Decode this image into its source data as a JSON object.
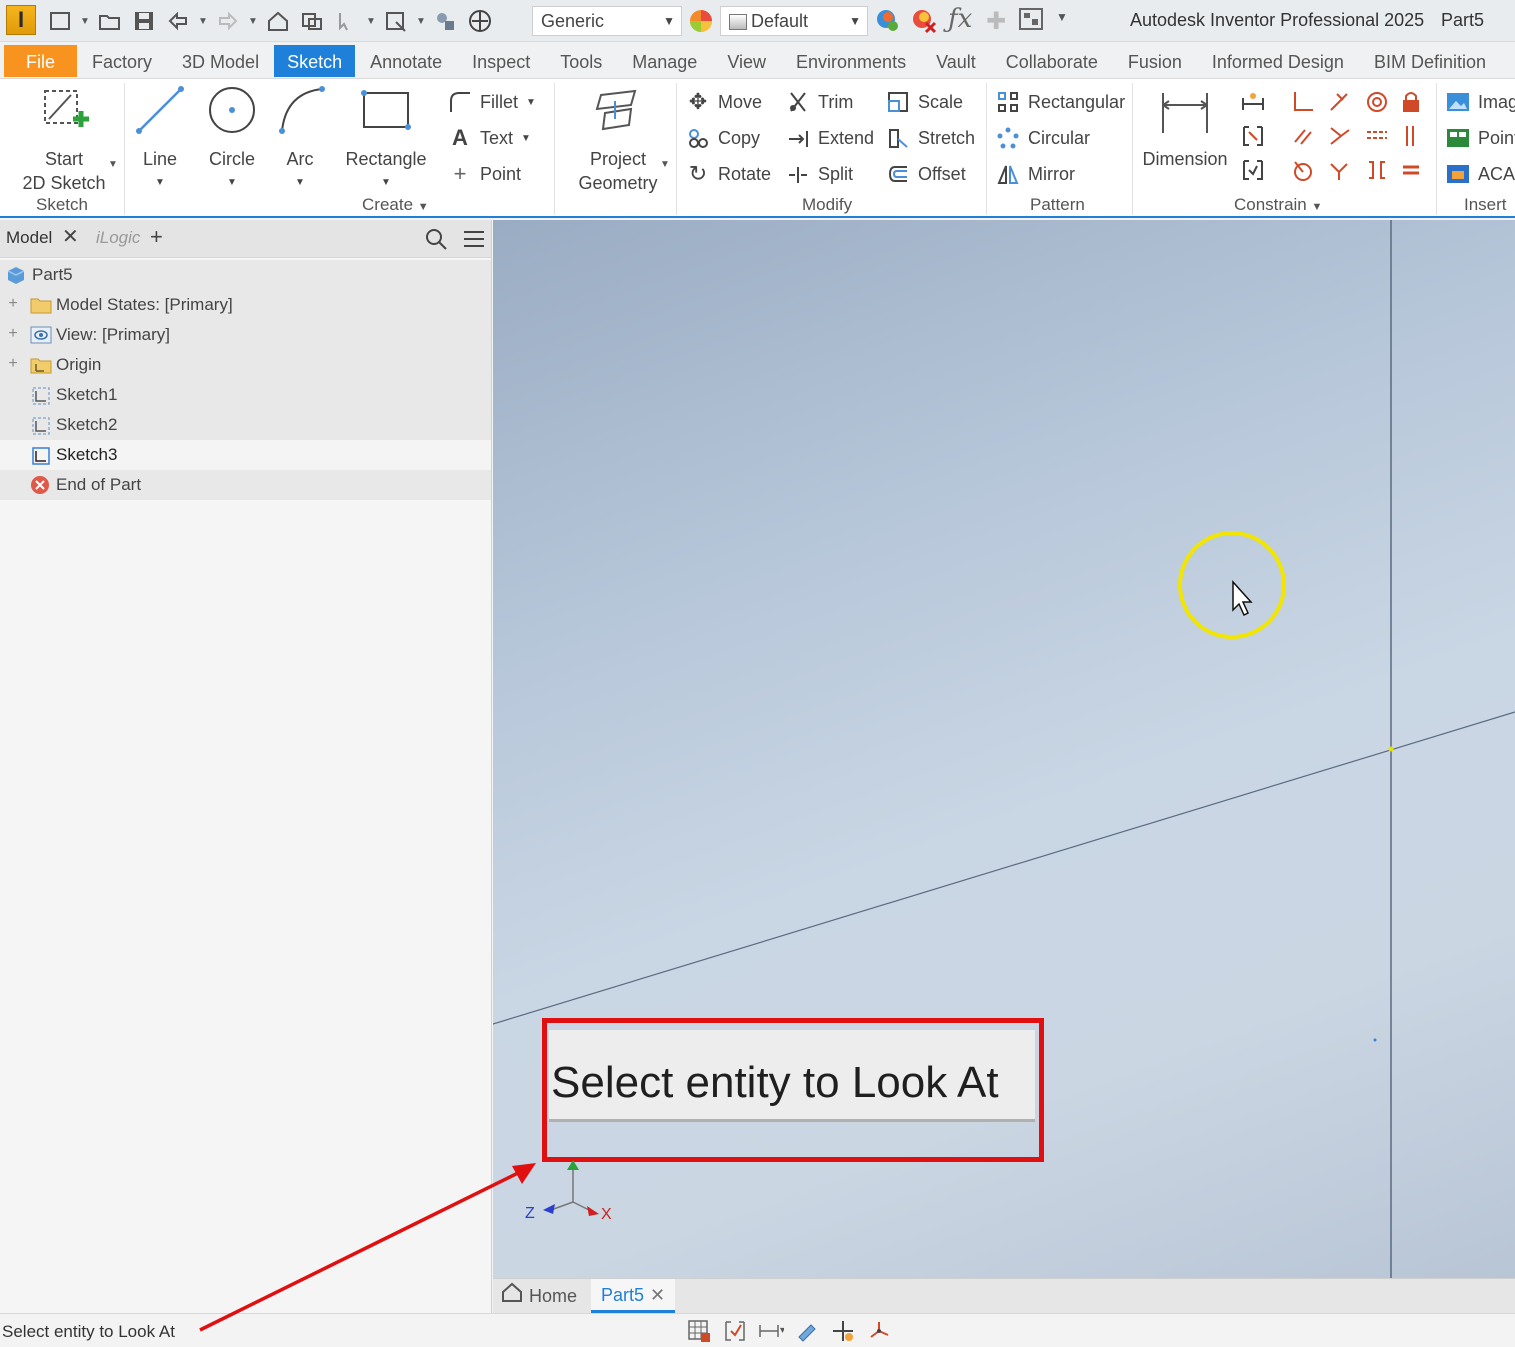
{
  "title_bar": {
    "app_logo": "I",
    "style_combo": "Generic",
    "appearance_combo": "Default",
    "app_title": "Autodesk Inventor Professional 2025",
    "document_name": "Part5"
  },
  "ribbon_tabs": [
    "File",
    "Factory",
    "3D Model",
    "Sketch",
    "Annotate",
    "Inspect",
    "Tools",
    "Manage",
    "View",
    "Environments",
    "Vault",
    "Collaborate",
    "Fusion",
    "Informed Design",
    "BIM Definition"
  ],
  "active_tab": "Sketch",
  "ribbon": {
    "sketch_panel": {
      "start_line1": "Start",
      "start_line2": "2D Sketch",
      "label": "Sketch"
    },
    "create_panel": {
      "line": "Line",
      "circle": "Circle",
      "arc": "Arc",
      "rectangle": "Rectangle",
      "fillet": "Fillet",
      "text": "Text",
      "point": "Point",
      "label": "Create"
    },
    "project": {
      "line1": "Project",
      "line2": "Geometry"
    },
    "modify_panel": {
      "move": "Move",
      "trim": "Trim",
      "scale": "Scale",
      "copy": "Copy",
      "extend": "Extend",
      "stretch": "Stretch",
      "rotate": "Rotate",
      "split": "Split",
      "offset": "Offset",
      "label": "Modify"
    },
    "pattern_panel": {
      "rectangular": "Rectangular",
      "circular": "Circular",
      "mirror": "Mirror",
      "label": "Pattern"
    },
    "constrain_panel": {
      "dimension": "Dimension",
      "label": "Constrain"
    },
    "insert_panel": {
      "image": "Imag",
      "points": "Point",
      "acad": "ACAI",
      "label": "Insert"
    }
  },
  "browser": {
    "tab_model": "Model",
    "tab_ilogic": "iLogic",
    "tree": {
      "root": "Part5",
      "model_states": "Model States: [Primary]",
      "view": "View: [Primary]",
      "origin": "Origin",
      "sketch1": "Sketch1",
      "sketch2": "Sketch2",
      "sketch3": "Sketch3",
      "end_of_part": "End of Part"
    }
  },
  "viewport": {
    "prompt_text": "Select entity to Look At",
    "axis_x": "X",
    "axis_z": "Z"
  },
  "document_tabs": {
    "home": "Home",
    "part": "Part5"
  },
  "status_bar": {
    "text": "Select entity to Look At"
  },
  "colors": {
    "accent": "#1e80d8",
    "file_tab": "#f7931e",
    "highlight_box": "#e01010",
    "cursor_ring": "#f2e600"
  }
}
